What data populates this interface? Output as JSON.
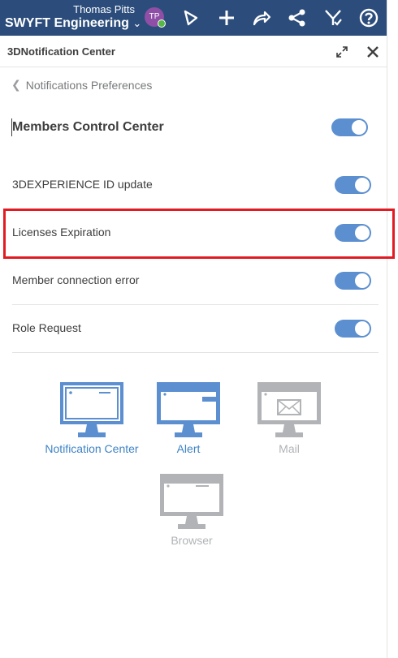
{
  "topbar": {
    "user_name": "Thomas Pitts",
    "tenant": "SWYFT Engineering",
    "tenant_chevron": "⌄",
    "avatar_initials": "TP",
    "background_color": "#2c4d7b",
    "icons": [
      "compass-icon",
      "add-icon",
      "share-icon",
      "social-icon",
      "collaborate-icon",
      "help-icon"
    ]
  },
  "panel": {
    "title": "3DNotification Center"
  },
  "back": {
    "label": "Notifications Preferences",
    "chevron": "❮"
  },
  "section": {
    "title": "Members Control Center",
    "enabled": true
  },
  "rows": [
    {
      "label": "3DEXPERIENCE ID update",
      "enabled": true
    },
    {
      "label": "Licenses Expiration",
      "enabled": true
    },
    {
      "label": "Member connection error",
      "enabled": true
    },
    {
      "label": "Role Request",
      "enabled": true
    }
  ],
  "channels": [
    {
      "label": "Notification Center",
      "active": true
    },
    {
      "label": "Alert",
      "active": true
    },
    {
      "label": "Mail",
      "active": false
    },
    {
      "label": "Browser",
      "active": false
    }
  ],
  "colors": {
    "toggle_on": "#5b8fd0",
    "channel_active": "#5b8fd0",
    "channel_inactive": "#b1b3b6",
    "highlight": "#e21b23"
  }
}
